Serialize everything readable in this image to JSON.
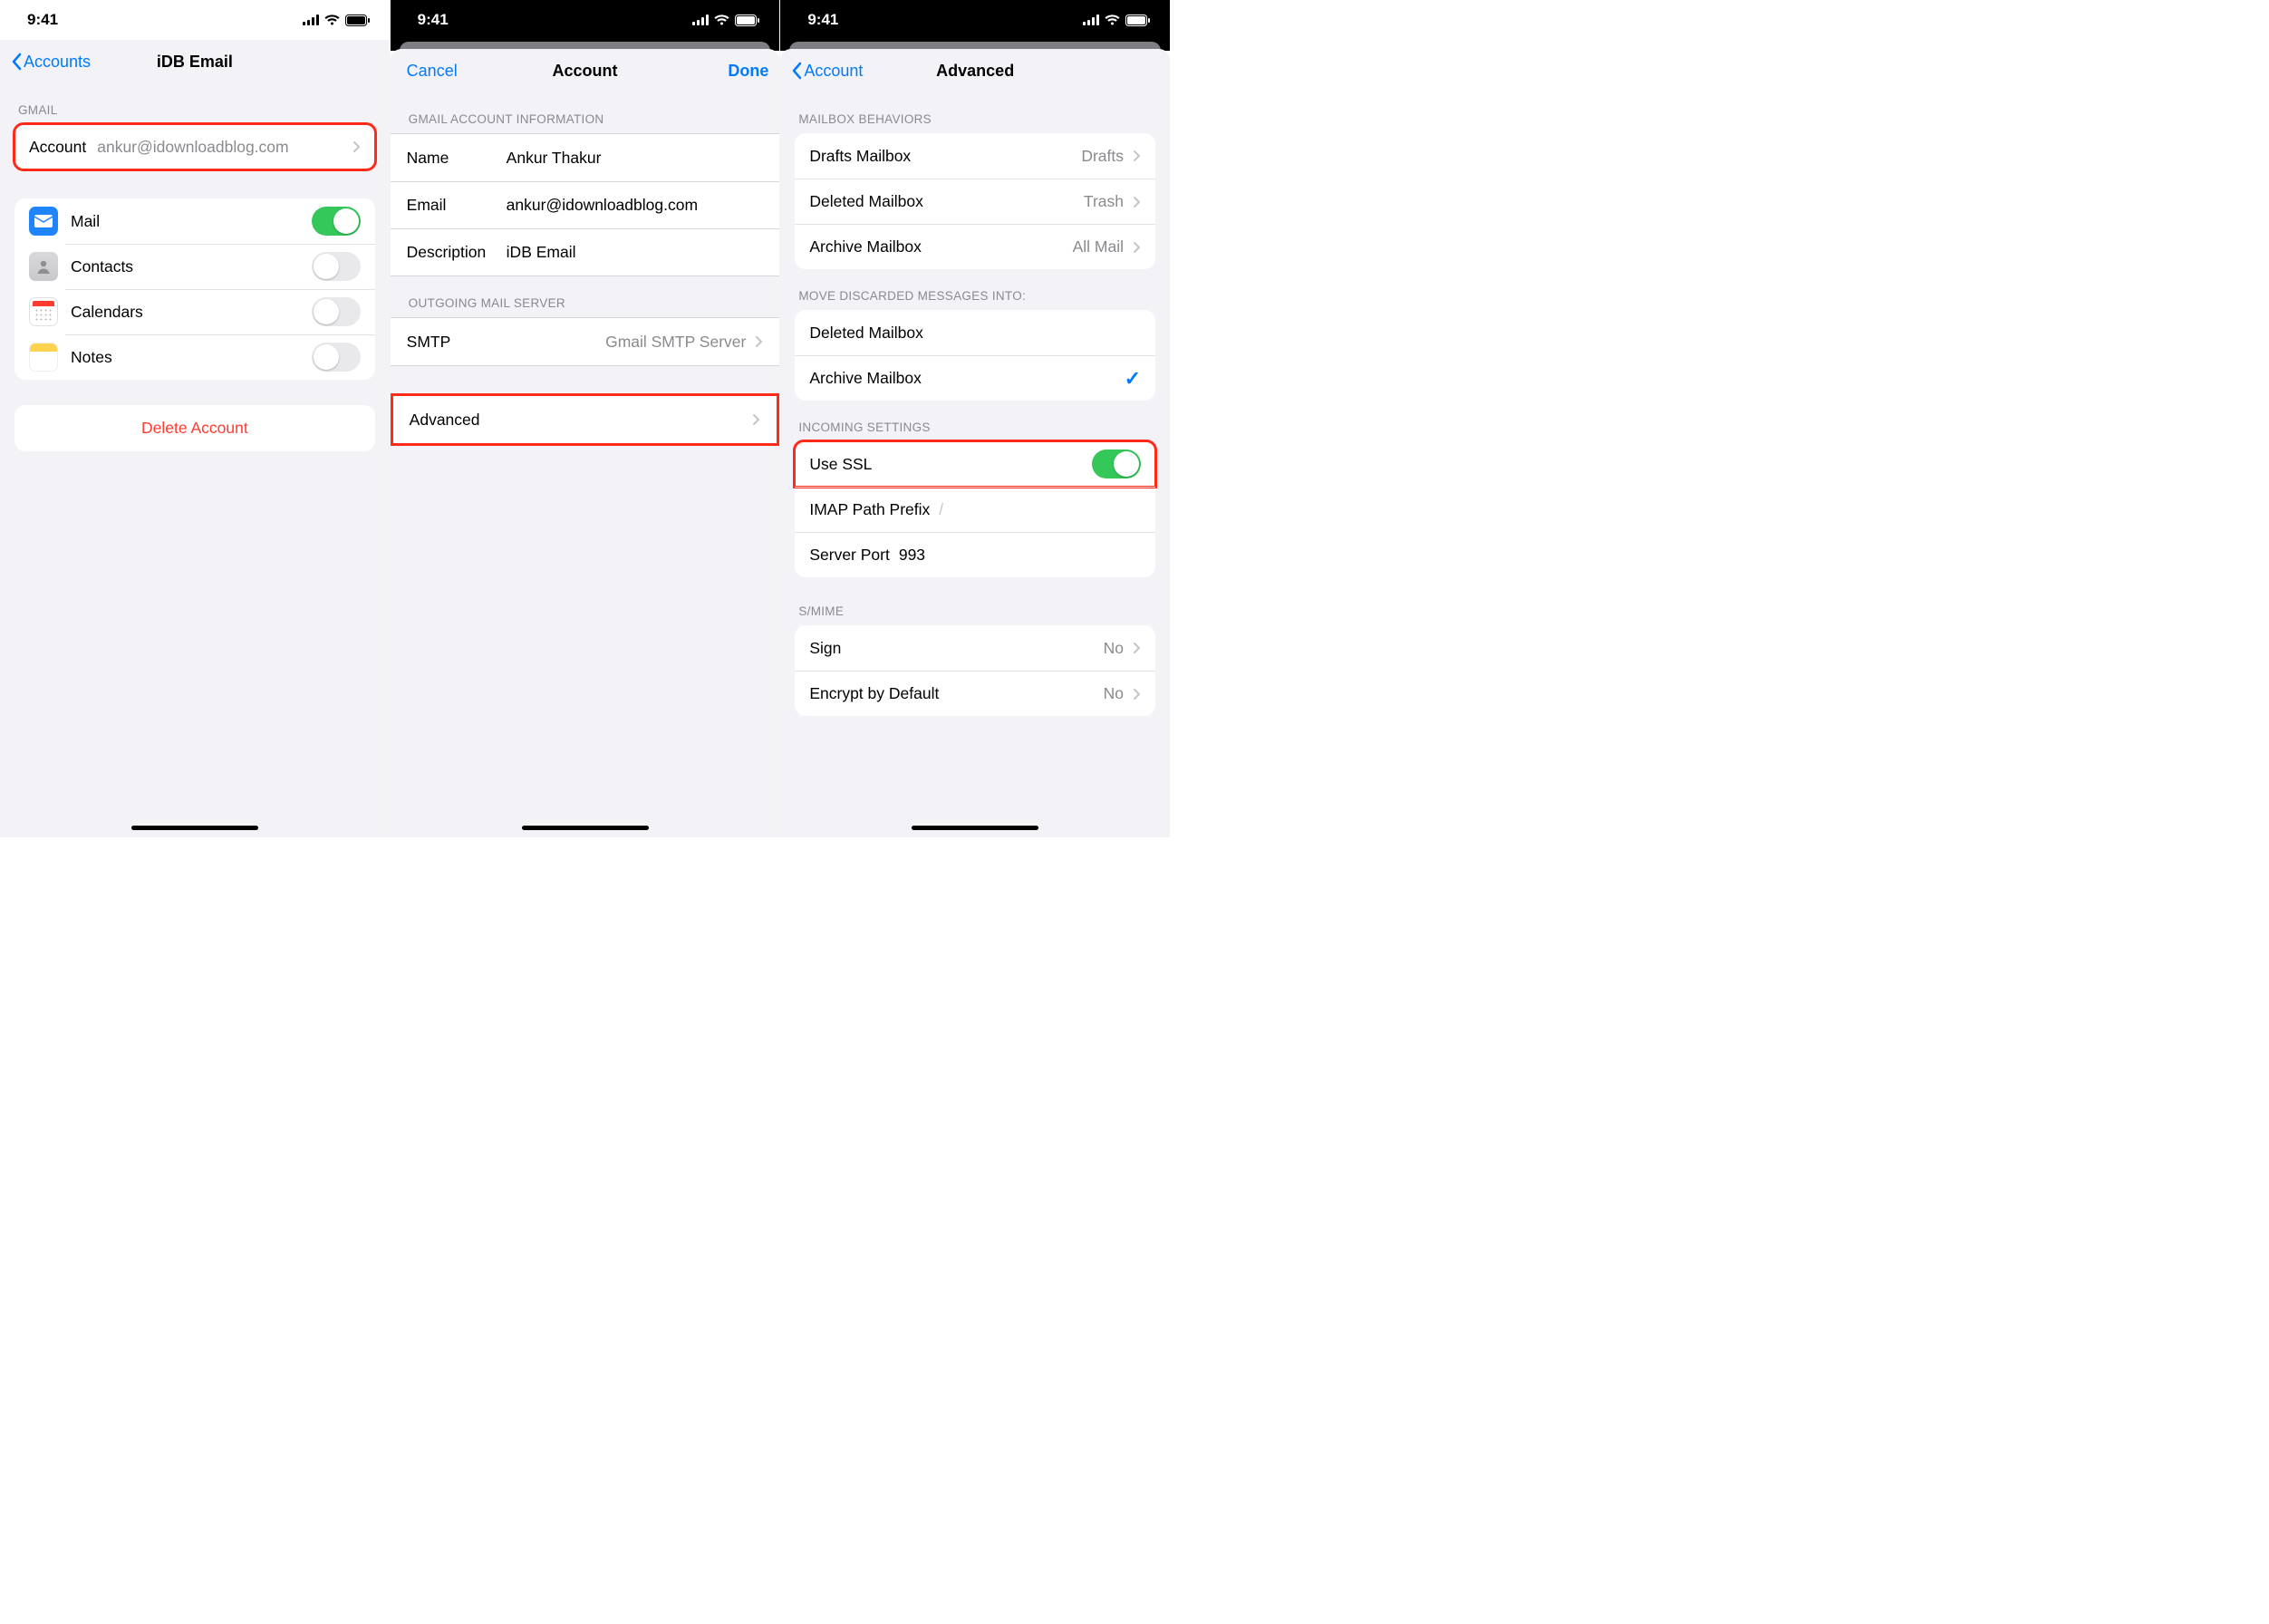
{
  "status": {
    "time": "9:41"
  },
  "screen1": {
    "back": "Accounts",
    "title": "iDB Email",
    "sec_gmail": "GMAIL",
    "account_label": "Account",
    "account_value": "ankur@idownloadblog.com",
    "mail": "Mail",
    "contacts": "Contacts",
    "calendars": "Calendars",
    "notes": "Notes",
    "delete": "Delete Account"
  },
  "screen2": {
    "cancel": "Cancel",
    "title": "Account",
    "done": "Done",
    "sec_info": "GMAIL ACCOUNT INFORMATION",
    "name_label": "Name",
    "name_value": "Ankur Thakur",
    "email_label": "Email",
    "email_value": "ankur@idownloadblog.com",
    "desc_label": "Description",
    "desc_value": "iDB Email",
    "sec_out": "OUTGOING MAIL SERVER",
    "smtp_label": "SMTP",
    "smtp_value": "Gmail SMTP Server",
    "advanced": "Advanced"
  },
  "screen3": {
    "back": "Account",
    "title": "Advanced",
    "sec_behaviors": "MAILBOX BEHAVIORS",
    "drafts_label": "Drafts Mailbox",
    "drafts_value": "Drafts",
    "deleted_label": "Deleted Mailbox",
    "deleted_value": "Trash",
    "archive_label": "Archive Mailbox",
    "archive_value": "All Mail",
    "sec_move": "MOVE DISCARDED MESSAGES INTO:",
    "move_deleted": "Deleted Mailbox",
    "move_archive": "Archive Mailbox",
    "sec_incoming": "INCOMING SETTINGS",
    "use_ssl": "Use SSL",
    "imap_prefix_label": "IMAP Path Prefix",
    "imap_prefix_value": "/",
    "port_label": "Server Port",
    "port_value": "993",
    "sec_smime": "S/MIME",
    "sign_label": "Sign",
    "sign_value": "No",
    "encrypt_label": "Encrypt by Default",
    "encrypt_value": "No"
  }
}
